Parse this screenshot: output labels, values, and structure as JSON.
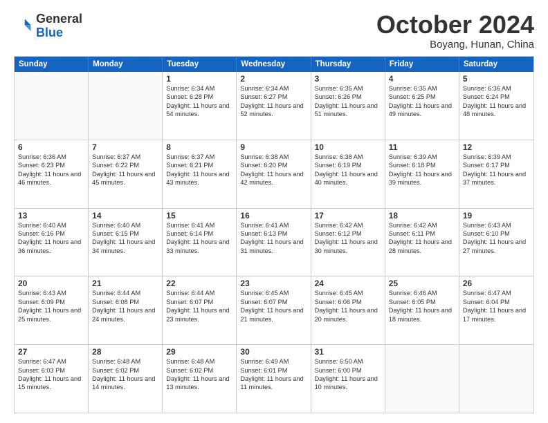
{
  "header": {
    "logo": {
      "general": "General",
      "blue": "Blue"
    },
    "title": "October 2024",
    "subtitle": "Boyang, Hunan, China"
  },
  "calendar": {
    "days_of_week": [
      "Sunday",
      "Monday",
      "Tuesday",
      "Wednesday",
      "Thursday",
      "Friday",
      "Saturday"
    ],
    "weeks": [
      [
        {
          "day": "",
          "text": "",
          "empty": true
        },
        {
          "day": "",
          "text": "",
          "empty": true
        },
        {
          "day": "1",
          "text": "Sunrise: 6:34 AM\nSunset: 6:28 PM\nDaylight: 11 hours and 54 minutes."
        },
        {
          "day": "2",
          "text": "Sunrise: 6:34 AM\nSunset: 6:27 PM\nDaylight: 11 hours and 52 minutes."
        },
        {
          "day": "3",
          "text": "Sunrise: 6:35 AM\nSunset: 6:26 PM\nDaylight: 11 hours and 51 minutes."
        },
        {
          "day": "4",
          "text": "Sunrise: 6:35 AM\nSunset: 6:25 PM\nDaylight: 11 hours and 49 minutes."
        },
        {
          "day": "5",
          "text": "Sunrise: 6:36 AM\nSunset: 6:24 PM\nDaylight: 11 hours and 48 minutes."
        }
      ],
      [
        {
          "day": "6",
          "text": "Sunrise: 6:36 AM\nSunset: 6:23 PM\nDaylight: 11 hours and 46 minutes."
        },
        {
          "day": "7",
          "text": "Sunrise: 6:37 AM\nSunset: 6:22 PM\nDaylight: 11 hours and 45 minutes."
        },
        {
          "day": "8",
          "text": "Sunrise: 6:37 AM\nSunset: 6:21 PM\nDaylight: 11 hours and 43 minutes."
        },
        {
          "day": "9",
          "text": "Sunrise: 6:38 AM\nSunset: 6:20 PM\nDaylight: 11 hours and 42 minutes."
        },
        {
          "day": "10",
          "text": "Sunrise: 6:38 AM\nSunset: 6:19 PM\nDaylight: 11 hours and 40 minutes."
        },
        {
          "day": "11",
          "text": "Sunrise: 6:39 AM\nSunset: 6:18 PM\nDaylight: 11 hours and 39 minutes."
        },
        {
          "day": "12",
          "text": "Sunrise: 6:39 AM\nSunset: 6:17 PM\nDaylight: 11 hours and 37 minutes."
        }
      ],
      [
        {
          "day": "13",
          "text": "Sunrise: 6:40 AM\nSunset: 6:16 PM\nDaylight: 11 hours and 36 minutes."
        },
        {
          "day": "14",
          "text": "Sunrise: 6:40 AM\nSunset: 6:15 PM\nDaylight: 11 hours and 34 minutes."
        },
        {
          "day": "15",
          "text": "Sunrise: 6:41 AM\nSunset: 6:14 PM\nDaylight: 11 hours and 33 minutes."
        },
        {
          "day": "16",
          "text": "Sunrise: 6:41 AM\nSunset: 6:13 PM\nDaylight: 11 hours and 31 minutes."
        },
        {
          "day": "17",
          "text": "Sunrise: 6:42 AM\nSunset: 6:12 PM\nDaylight: 11 hours and 30 minutes."
        },
        {
          "day": "18",
          "text": "Sunrise: 6:42 AM\nSunset: 6:11 PM\nDaylight: 11 hours and 28 minutes."
        },
        {
          "day": "19",
          "text": "Sunrise: 6:43 AM\nSunset: 6:10 PM\nDaylight: 11 hours and 27 minutes."
        }
      ],
      [
        {
          "day": "20",
          "text": "Sunrise: 6:43 AM\nSunset: 6:09 PM\nDaylight: 11 hours and 25 minutes."
        },
        {
          "day": "21",
          "text": "Sunrise: 6:44 AM\nSunset: 6:08 PM\nDaylight: 11 hours and 24 minutes."
        },
        {
          "day": "22",
          "text": "Sunrise: 6:44 AM\nSunset: 6:07 PM\nDaylight: 11 hours and 23 minutes."
        },
        {
          "day": "23",
          "text": "Sunrise: 6:45 AM\nSunset: 6:07 PM\nDaylight: 11 hours and 21 minutes."
        },
        {
          "day": "24",
          "text": "Sunrise: 6:45 AM\nSunset: 6:06 PM\nDaylight: 11 hours and 20 minutes."
        },
        {
          "day": "25",
          "text": "Sunrise: 6:46 AM\nSunset: 6:05 PM\nDaylight: 11 hours and 18 minutes."
        },
        {
          "day": "26",
          "text": "Sunrise: 6:47 AM\nSunset: 6:04 PM\nDaylight: 11 hours and 17 minutes."
        }
      ],
      [
        {
          "day": "27",
          "text": "Sunrise: 6:47 AM\nSunset: 6:03 PM\nDaylight: 11 hours and 15 minutes."
        },
        {
          "day": "28",
          "text": "Sunrise: 6:48 AM\nSunset: 6:02 PM\nDaylight: 11 hours and 14 minutes."
        },
        {
          "day": "29",
          "text": "Sunrise: 6:48 AM\nSunset: 6:02 PM\nDaylight: 11 hours and 13 minutes."
        },
        {
          "day": "30",
          "text": "Sunrise: 6:49 AM\nSunset: 6:01 PM\nDaylight: 11 hours and 11 minutes."
        },
        {
          "day": "31",
          "text": "Sunrise: 6:50 AM\nSunset: 6:00 PM\nDaylight: 11 hours and 10 minutes."
        },
        {
          "day": "",
          "text": "",
          "empty": true
        },
        {
          "day": "",
          "text": "",
          "empty": true
        }
      ]
    ]
  }
}
